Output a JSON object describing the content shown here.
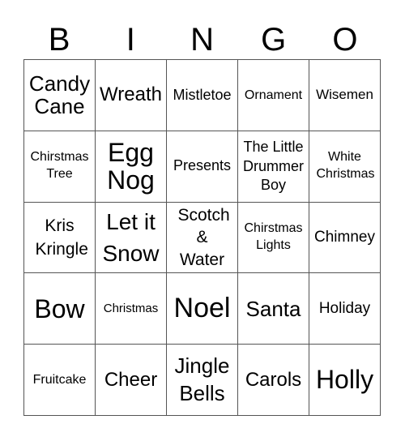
{
  "header": {
    "letters": [
      "B",
      "I",
      "N",
      "G",
      "O"
    ]
  },
  "board": {
    "rows": [
      [
        "Candy Cane",
        "Wreath",
        "Mistletoe",
        "Ornament",
        "Wisemen"
      ],
      [
        "Chirstmas Tree",
        "Egg Nog",
        "Presents",
        "The Little Drummer Boy",
        "White Christmas"
      ],
      [
        "Kris Kringle",
        "Let it Snow",
        "Scotch & Water",
        "Chirstmas Lights",
        "Chimney"
      ],
      [
        "Bow",
        "Christmas",
        "Noel",
        "Santa",
        "Holiday"
      ],
      [
        "Fruitcake",
        "Cheer",
        "Jingle Bells",
        "Carols",
        "Holly"
      ]
    ]
  }
}
